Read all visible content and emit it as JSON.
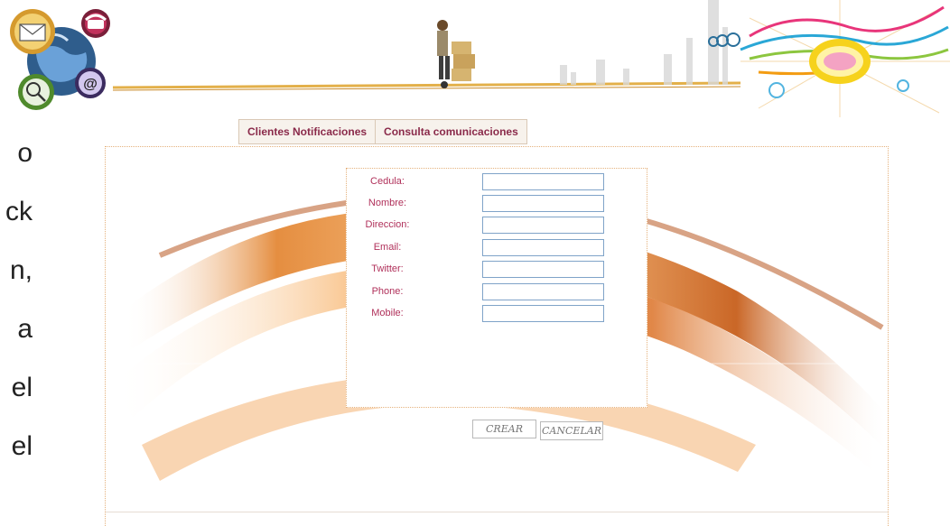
{
  "side_text": [
    "o",
    "ck",
    "n,",
    "a",
    "el",
    "el"
  ],
  "tabs": [
    {
      "label": "Clientes Notificaciones"
    },
    {
      "label": "Consulta comunicaciones"
    }
  ],
  "form": {
    "fields": [
      {
        "label": "Cedula:",
        "value": ""
      },
      {
        "label": "Nombre:",
        "value": ""
      },
      {
        "label": "Direccion:",
        "value": ""
      },
      {
        "label": "Email:",
        "value": ""
      },
      {
        "label": "Twitter:",
        "value": ""
      },
      {
        "label": "Phone:",
        "value": ""
      },
      {
        "label": "Mobile:",
        "value": ""
      }
    ]
  },
  "buttons": {
    "crear": "CREAR",
    "cancelar": "CANCELAR"
  },
  "colors": {
    "accent": "#b0305a",
    "tab_text": "#8a2a4a",
    "swoosh": "#e07a1f",
    "input_border": "#7fa3c8"
  },
  "icons": [
    "envelope-icon",
    "telephone-icon",
    "globe-icon",
    "magnifier-globe-icon",
    "at-sign-icon",
    "delivery-man-icon",
    "skyline-icon",
    "sunburst-graphic-icon"
  ]
}
